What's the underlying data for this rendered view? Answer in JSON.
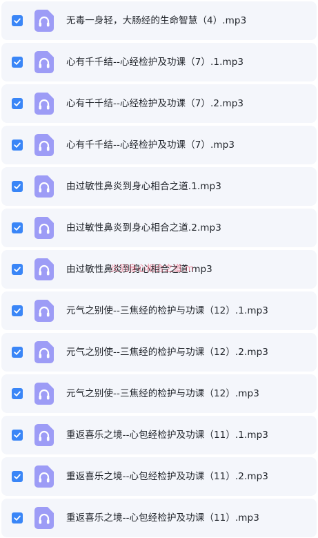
{
  "colors": {
    "row_background": "#f4f6fb",
    "checkbox": "#3a86f7",
    "file_icon": "#9d9cf6",
    "text": "#1f2329"
  },
  "file_icon_name": "audio-file-headphones-icon",
  "checkbox_icon_name": "checkmark-icon",
  "files": [
    {
      "name": "无毒一身轻，大肠经的生命智慧（4）.mp3",
      "checked": true
    },
    {
      "name": "心有千千结--心经检护及功课（7）.1.mp3",
      "checked": true
    },
    {
      "name": "心有千千结--心经检护及功课（7）.2.mp3",
      "checked": true
    },
    {
      "name": "心有千千结--心经检护及功课（7）.mp3",
      "checked": true
    },
    {
      "name": "由过敏性鼻炎到身心相合之道.1.mp3",
      "checked": true
    },
    {
      "name": "由过敏性鼻炎到身心相合之道.2.mp3",
      "checked": true
    },
    {
      "name": "由过敏性鼻炎到身心相合之道.mp3",
      "checked": true
    },
    {
      "name": "元气之别使--三焦经的检护与功课（12）.1.mp3",
      "checked": true
    },
    {
      "name": "元气之别使--三焦经的检护与功课（12）.2.mp3",
      "checked": true
    },
    {
      "name": "元气之别使--三焦经的检护与功课（12）.mp3",
      "checked": true
    },
    {
      "name": "重返喜乐之境--心包经检护及功课（11）.1.mp3",
      "checked": true
    },
    {
      "name": "重返喜乐之境--心包经检护及功课（11）.2.mp3",
      "checked": true
    },
    {
      "name": "重返喜乐之境--心包经检护及功课（11）.mp3",
      "checked": true
    }
  ],
  "watermark": "炎到身心相合之道.m"
}
